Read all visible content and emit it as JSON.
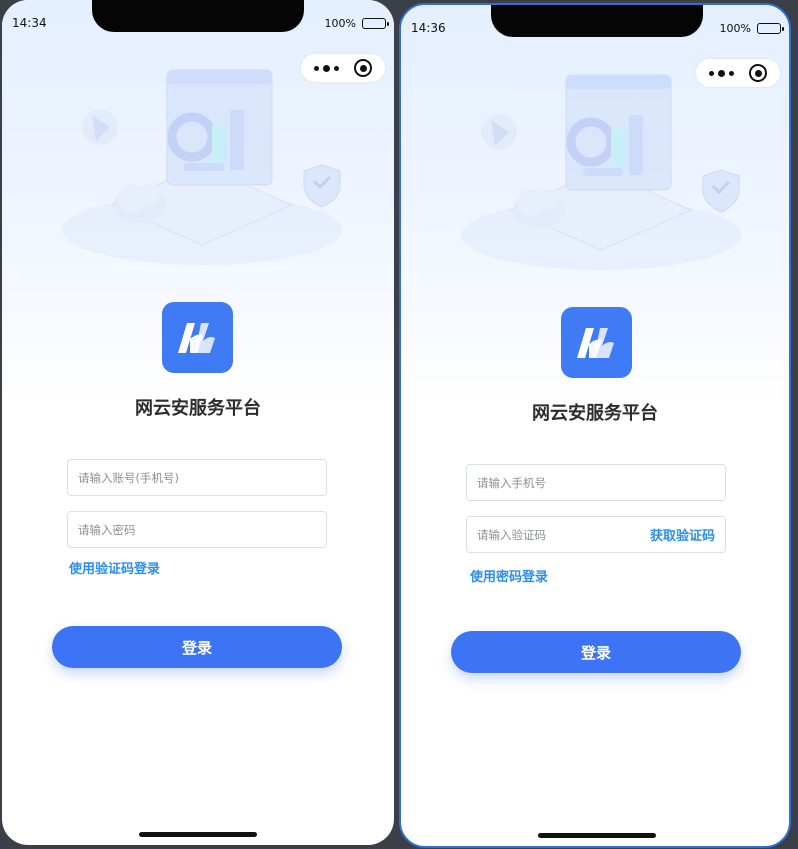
{
  "colors": {
    "accent": "#3d74f6",
    "link": "#2a8ef0",
    "logo_bg": "#3f7bf5"
  },
  "left": {
    "status": {
      "time": "14:34",
      "battery": "100%"
    },
    "capsule": {
      "menu_icon": "more-dots-icon",
      "close_icon": "target-circle-icon"
    },
    "app_title": "网云安服务平台",
    "account_placeholder": "请输入账号(手机号)",
    "password_placeholder": "请输入密码",
    "switch_link": "使用验证码登录",
    "login_button": "登录"
  },
  "right": {
    "status": {
      "time": "14:36",
      "battery": "100%"
    },
    "capsule": {
      "menu_icon": "more-dots-icon",
      "close_icon": "target-circle-icon"
    },
    "app_title": "网云安服务平台",
    "phone_placeholder": "请输入手机号",
    "code_placeholder": "请输入验证码",
    "get_code_link": "获取验证码",
    "switch_link": "使用密码登录",
    "login_button": "登录"
  }
}
